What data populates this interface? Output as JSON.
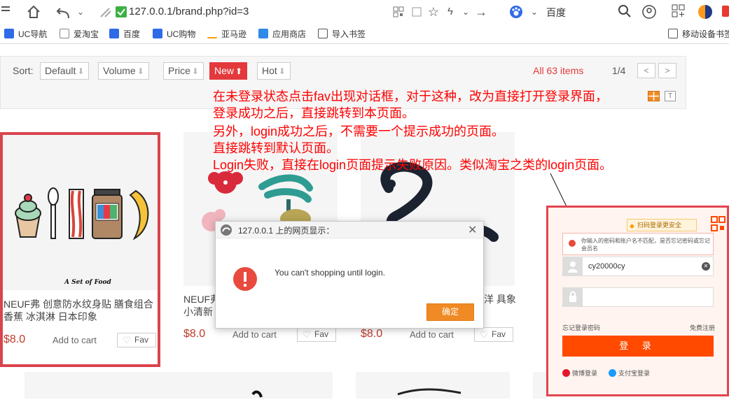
{
  "browser": {
    "url": "127.0.0.1/brand.php?id=3",
    "search_engine": "百度",
    "bookmarks": [
      "UC导航",
      "爱淘宝",
      "百度",
      "UC购物",
      "亚马逊",
      "应用商店",
      "导入书签",
      "移动设备书签"
    ]
  },
  "sortbar": {
    "label": "Sort:",
    "buttons": [
      {
        "label": "Default",
        "arrow": "⬇"
      },
      {
        "label": "Volume",
        "arrow": "⬇"
      },
      {
        "label": "Price",
        "arrow": "⬇"
      },
      {
        "label": "New",
        "arrow": "⬆"
      },
      {
        "label": "Hot",
        "arrow": "⬇"
      }
    ],
    "items_count": "All 63 items",
    "page_info": "1/4"
  },
  "annotation": [
    "在未登录状态点击fav出现对话框，对于这种，改为直接打开登录界面，",
    "登录成功之后，直接跳转到本页面。",
    "另外，login成功之后，不需要一个提示成功的页面。",
    "直接跳转到默认页面。",
    "Login失败，直接在login页面提示失败原因。类似淘宝之类的login页面。"
  ],
  "products": [
    {
      "name": "NEUF弗 创意防水纹身贴 膳食组合 香蕉 冰淇淋 日本印象",
      "image_caption": "A Set of Food",
      "price": "$8.0",
      "cart": "Add to cart",
      "fav": "Fav"
    },
    {
      "name": "NEUF弗 小清新",
      "price": "$8.0",
      "cart": "Add to cart",
      "fav": "Fav"
    },
    {
      "name": "洋 具象",
      "price": "$8.0",
      "cart": "Add to cart",
      "fav": "Fav"
    }
  ],
  "dialog": {
    "title": "127.0.0.1 上的网页显示：",
    "message": "You can't shopping until login.",
    "ok": "确定"
  },
  "login": {
    "qr_tip": "扫码登录更安全",
    "error": "你输入的密码和账户名不匹配，是否忘记密码或忘记会员名",
    "username": "cy20000cy",
    "forgot": "忘记登录密码",
    "register": "免费注册",
    "submit": "登 录",
    "weibo": "微博登录",
    "alipay": "支付宝登录"
  },
  "colors": {
    "accent": "#e4393c",
    "annotation": "#ff0000",
    "login_btn": "#ff4a00",
    "dialog_ok": "#f08a24"
  }
}
